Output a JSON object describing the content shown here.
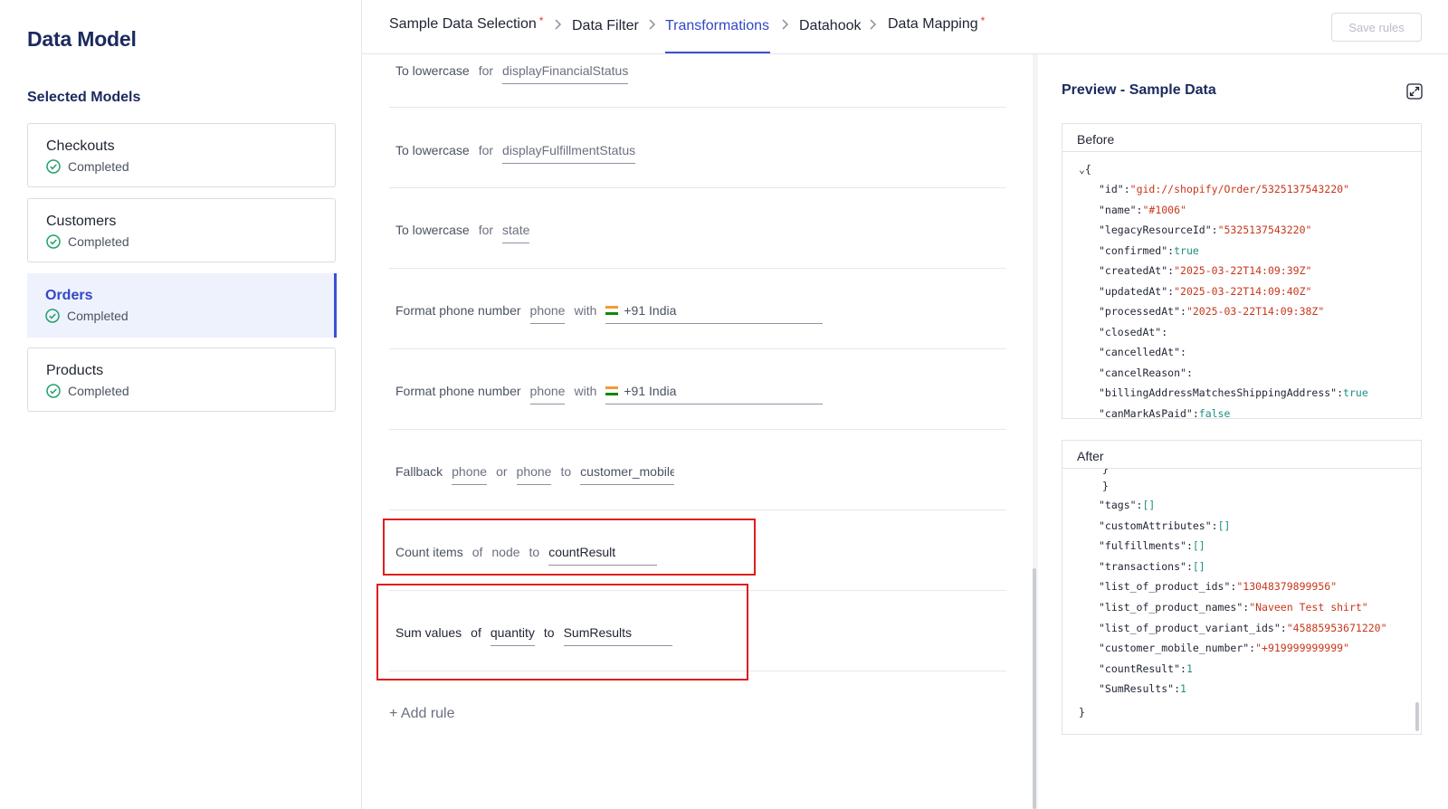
{
  "sidebar": {
    "title": "Data Model",
    "subtitle": "Selected Models",
    "models": [
      {
        "name": "Checkouts",
        "status": "Completed"
      },
      {
        "name": "Customers",
        "status": "Completed"
      },
      {
        "name": "Orders",
        "status": "Completed",
        "active": true
      },
      {
        "name": "Products",
        "status": "Completed"
      }
    ]
  },
  "header": {
    "steps": [
      {
        "label": "Sample Data Selection",
        "required": "*"
      },
      {
        "label": "Data Filter"
      },
      {
        "label": "Transformations",
        "active": true
      },
      {
        "label": "Datahook"
      },
      {
        "label": "Data Mapping",
        "required": "*"
      }
    ],
    "save_label": "Save rules"
  },
  "rules": [
    {
      "parts": [
        "To lowercase",
        "for",
        "displayFinancialStatus"
      ]
    },
    {
      "parts": [
        "To lowercase",
        "for",
        "displayFulfillmentStatus"
      ]
    },
    {
      "parts": [
        "To lowercase",
        "for",
        "state"
      ]
    },
    {
      "parts": [
        "Format phone number",
        "phone",
        "with",
        "+91 India"
      ]
    },
    {
      "parts": [
        "Format phone number",
        "phone",
        "with",
        "+91 India"
      ]
    },
    {
      "parts": [
        "Fallback",
        "phone",
        "or",
        "phone",
        "to",
        "customer_mobile"
      ]
    },
    {
      "parts": [
        "Count items",
        "of",
        "node",
        "to",
        "countResult"
      ]
    },
    {
      "parts": [
        "Sum values",
        "of",
        "quantity",
        "to",
        "SumResults"
      ]
    }
  ],
  "add_rule_label": "+ Add rule",
  "preview": {
    "title": "Preview - Sample Data",
    "before": {
      "label": "Before",
      "lines": [
        {
          "k": "\"id\"",
          "v": "\"gid://shopify/Order/5325137543220\"",
          "t": "s"
        },
        {
          "k": "\"name\"",
          "v": "\"#1006\"",
          "t": "s"
        },
        {
          "k": "\"legacyResourceId\"",
          "v": "\"5325137543220\"",
          "t": "s"
        },
        {
          "k": "\"confirmed\"",
          "v": "true",
          "t": "b"
        },
        {
          "k": "\"createdAt\"",
          "v": "\"2025-03-22T14:09:39Z\"",
          "t": "s"
        },
        {
          "k": "\"updatedAt\"",
          "v": "\"2025-03-22T14:09:40Z\"",
          "t": "s"
        },
        {
          "k": "\"processedAt\"",
          "v": "\"2025-03-22T14:09:38Z\"",
          "t": "s"
        },
        {
          "k": "\"closedAt\"",
          "v": "",
          "t": "s"
        },
        {
          "k": "\"cancelledAt\"",
          "v": "",
          "t": "s"
        },
        {
          "k": "\"cancelReason\"",
          "v": "",
          "t": "s"
        },
        {
          "k": "\"billingAddressMatchesShippingAddress\"",
          "v": "true",
          "t": "b"
        },
        {
          "k": "\"canMarkAsPaid\"",
          "v": "false",
          "t": "b"
        }
      ]
    },
    "after": {
      "label": "After",
      "lines": [
        {
          "k": "\"tags\"",
          "v": "[]",
          "t": "b"
        },
        {
          "k": "\"customAttributes\"",
          "v": "[]",
          "t": "b"
        },
        {
          "k": "\"fulfillments\"",
          "v": "[]",
          "t": "b"
        },
        {
          "k": "\"transactions\"",
          "v": "[]",
          "t": "b"
        },
        {
          "k": "\"list_of_product_ids\"",
          "v": "\"13048379899956\"",
          "t": "s"
        },
        {
          "k": "\"list_of_product_names\"",
          "v": "\"Naveen Test shirt\"",
          "t": "s"
        },
        {
          "k": "\"list_of_product_variant_ids\"",
          "v": "\"45885953671220\"",
          "t": "s"
        },
        {
          "k": "\"customer_mobile_number\"",
          "v": "\"+919999999999\"",
          "t": "s"
        },
        {
          "k": "\"countResult\"",
          "v": "1",
          "t": "b"
        },
        {
          "k": "\"SumResults\"",
          "v": "1",
          "t": "b"
        }
      ]
    }
  },
  "colors": {
    "accent": "#3b4fd8",
    "highlight": "#e11d1d",
    "success": "#22a06b"
  }
}
